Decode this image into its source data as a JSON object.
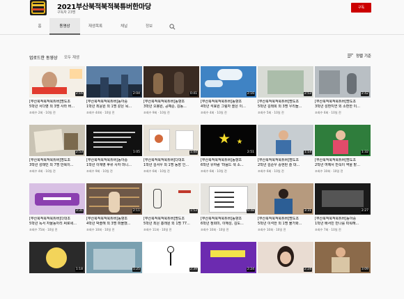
{
  "channel": {
    "title": "2021부산북적북적북튜버한마당",
    "subscribers": "구독자 23명",
    "subscribe_label": "구독",
    "avatar_icon": "channel-logo"
  },
  "tabs": [
    {
      "label": "홈",
      "active": false
    },
    {
      "label": "동영상",
      "active": true
    },
    {
      "label": "재생목록",
      "active": false
    },
    {
      "label": "채널",
      "active": false
    },
    {
      "label": "정보",
      "active": false
    }
  ],
  "section": {
    "title": "업로드한 동영상",
    "play_all": "모두 재생",
    "sort_label": "정렬 기준"
  },
  "videos": [
    {
      "line1": "[부산북적북적북튜버]명도초",
      "line2": "5학년 서다영 외 3명 사라 버...",
      "meta": "조회수 2회 · 10일 전",
      "duration": "2:16",
      "bg": "#f4efe6",
      "art": "face-tags",
      "accent": "#e23b2e"
    },
    {
      "line1": "[부산북적북적북튜버]동아중",
      "line2": "1학년 최윤원 외 1명 같은 목...",
      "meta": "조회수 44회 · 10일 전",
      "duration": "2:04",
      "bg": "#5b7fa6",
      "art": "city",
      "accent": "#bcd0e6"
    },
    {
      "line1": "[부산북적북적북튜버]동향초",
      "line2": "3학년 오봉원, 공예준, 김동...",
      "meta": "조회수 9회 · 10일 전",
      "duration": "0:41",
      "bg": "#3a2b22",
      "art": "people",
      "accent": "#8a6a4a"
    },
    {
      "line1": "[부산북적북적북튜버]동향초",
      "line2": "4학년 석효원 그림자 쓸은 이...",
      "meta": "조회수 4회 · 10일 전",
      "duration": "2:16",
      "bg": "#3f83c4",
      "art": "sky",
      "accent": "#ffffff"
    },
    {
      "line1": "[부산북적북적북튜버]명도초",
      "line2": "5학년 김태희 외 3명 우리들...",
      "meta": "조회수 5회 · 10일 전",
      "duration": "2:53",
      "bg": "#d8dbd5",
      "art": "book",
      "accent": "#7ea07f"
    },
    {
      "line1": "[부산북적북적북튜버]명도초",
      "line2": "3학년 성환지연 외 소환한 이...",
      "meta": "조회수 6회 · 10일 전",
      "duration": "2:42",
      "bg": "#b9bfc4",
      "art": "room",
      "accent": "#8f969b"
    },
    {
      "line1": "[부산북적북적북튜버]명도초",
      "line2": "3학년 성태민 외 7명 만복이...",
      "meta": "조회수 4회 · 10일 전",
      "duration": "2:53",
      "bg": "#c9c3b4",
      "art": "paper",
      "accent": "#7b6a4e"
    },
    {
      "line1": "[부산북적북적북튜버]동아중",
      "line2": "1학년 이재영 후류 사자 마니...",
      "meta": "조회수 9회 · 10일 전",
      "duration": "1:05",
      "bg": "#111111",
      "art": "text",
      "accent": "#cfcfcf"
    },
    {
      "line1": "[부산북적북적북튜버]다대초",
      "line2": "1학년 김서우 외 1명 동장 인...",
      "meta": "조회수 6회 · 10일 전",
      "duration": "1:44",
      "bg": "#e7e2d8",
      "art": "draw",
      "accent": "#d26a3c"
    },
    {
      "line1": "[부산북적북적북튜버]동향초",
      "line2": "6학년 유하람 '마음드 색 소...",
      "meta": "조회수 6회 · 10일 전",
      "duration": "2:51",
      "bg": "#050505",
      "art": "stars",
      "accent": "#f5dc2a"
    },
    {
      "line1": "[부산북적북적북튜버]명도초",
      "line2": "2학년 김준우 중현된 슬 대...",
      "meta": "조회수 6회 · 10일 전",
      "duration": "1:14",
      "bg": "#c7cdd1",
      "art": "kid",
      "accent": "#3d6fa8"
    },
    {
      "line1": "[부산북적북적북튜버]명도초",
      "line2": "2학년 여예서 반쪽이 역을 맡...",
      "meta": "조회수 10회 · 10일 전",
      "duration": "1:32",
      "bg": "#2f7d3c",
      "art": "kid2",
      "accent": "#e24b6a"
    },
    {
      "line1": "[부산북적북적북튜버]다대초",
      "line2": "5학년 독서 자율동아리 써로세...",
      "meta": "조회수 75회 · 10일 전",
      "duration": "3:31",
      "bg": "#d8c0e4",
      "art": "purple",
      "accent": "#8b3fb0"
    },
    {
      "line1": "[부산북적북적북튜버]동향초",
      "line2": "4학년 박솔해 외 3명 퍼블했...",
      "meta": "조회수 10회 · 10일 전",
      "duration": "2:11",
      "bg": "#6e5848",
      "art": "shelf",
      "accent": "#c49b64"
    },
    {
      "line1": "[부산북적북적북튜버]명도초",
      "line2": "5학년 최은 홍래원 외 1명 77...",
      "meta": "조회수 11회 · 10일 전",
      "duration": "1:53",
      "bg": "#f3f1ec",
      "art": "sketch",
      "accent": "#444444"
    },
    {
      "line1": "[부산북적북적북튜버]동향초",
      "line2": "6학년 정회미, 이해성, 김도...",
      "meta": "조회수 10회 · 10일 전",
      "duration": "0:48",
      "bg": "#e6e4df",
      "art": "list",
      "accent": "#333333"
    },
    {
      "line1": "[부산북적북적북튜버]명도초",
      "line2": "5학년 이석한 외 1명 불가화...",
      "meta": "조회수 10회 · 10일 전",
      "duration": "3:31",
      "bg": "#b69a7e",
      "art": "kid3",
      "accent": "#2c5e95"
    },
    {
      "line1": "[부산북적북적북튜버]동아중",
      "line2": "1학년 배서빈 만나를 따워해...",
      "meta": "조회수 7회 · 10일 전",
      "duration": "2:27",
      "bg": "#1b1b1b",
      "art": "dark",
      "accent": "#555555"
    },
    {
      "line1": "",
      "line2": "",
      "meta": "",
      "duration": "1:18",
      "bg": "#2a2a2a",
      "art": "emblem",
      "accent": "#f3d45a"
    },
    {
      "line1": "",
      "line2": "",
      "meta": "",
      "duration": "1:25",
      "bg": "#7aa0b0",
      "art": "blue",
      "accent": "#d8e4ea"
    },
    {
      "line1": "",
      "line2": "",
      "meta": "",
      "duration": "2:39",
      "bg": "#ffffff",
      "art": "figure",
      "accent": "#111111"
    },
    {
      "line1": "",
      "line2": "",
      "meta": "",
      "duration": "2:24",
      "bg": "#6c2bb0",
      "art": "purple2",
      "accent": "#f3e34a"
    },
    {
      "line1": "",
      "line2": "",
      "meta": "",
      "duration": "2:24",
      "bg": "#e9dcd2",
      "art": "face",
      "accent": "#2a1d18"
    },
    {
      "line1": "",
      "line2": "",
      "meta": "",
      "duration": "3:09",
      "bg": "#8b6a4a",
      "art": "kid4",
      "accent": "#d9c6a5"
    }
  ]
}
